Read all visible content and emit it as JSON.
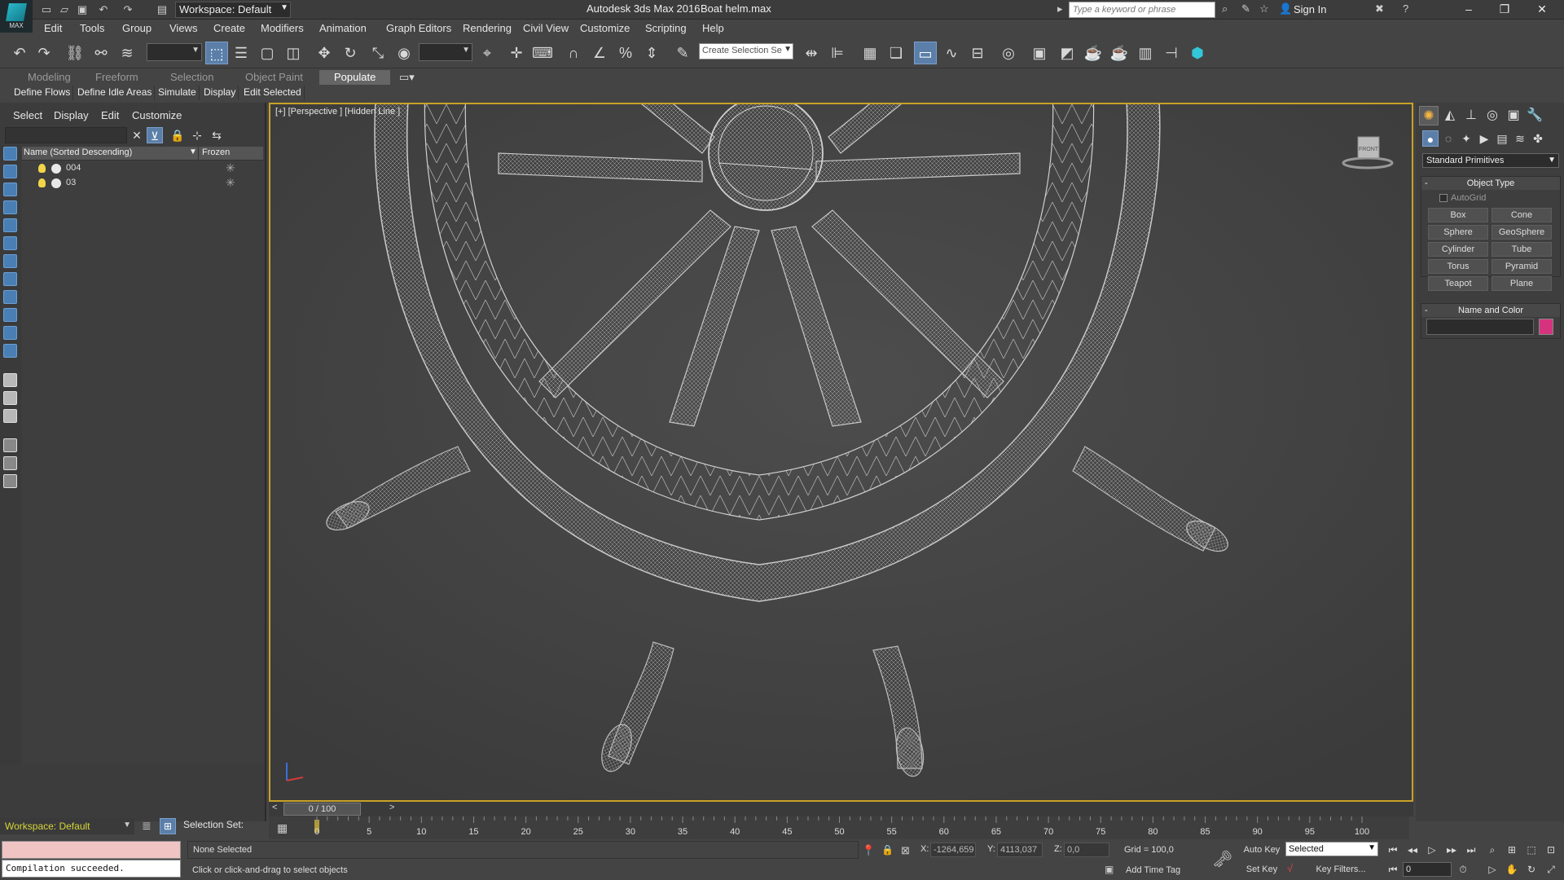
{
  "titlebar": {
    "app_title": "Autodesk 3ds Max 2016",
    "file_name": "Boat helm.max",
    "workspace": "Workspace: Default",
    "search_placeholder": "Type a keyword or phrase",
    "sign_in": "Sign In",
    "logo_text": "MAX",
    "minimize": "–",
    "restore": "❐",
    "close": "✕",
    "help": "?"
  },
  "menu": [
    "Edit",
    "Tools",
    "Group",
    "Views",
    "Create",
    "Modifiers",
    "Animation",
    "Graph Editors",
    "Rendering",
    "Civil View",
    "Customize",
    "Scripting",
    "Help"
  ],
  "toolbar": {
    "selection_set_placeholder": "Create Selection Se"
  },
  "ribbon": {
    "tabs": [
      "Modeling",
      "Freeform",
      "Selection",
      "Object Paint",
      "Populate"
    ],
    "active_tab": "Populate",
    "subtabs": [
      "Define Flows",
      "Define Idle Areas",
      "Simulate",
      "Display",
      "Edit Selected"
    ]
  },
  "scene_explorer": {
    "menus": [
      "Select",
      "Display",
      "Edit",
      "Customize"
    ],
    "columns": {
      "name": "Name (Sorted Descending)",
      "frozen": "Frozen"
    },
    "rows": [
      {
        "name": "004"
      },
      {
        "name": "03"
      }
    ]
  },
  "viewport": {
    "label": "[+] [Perspective ] [Hidden Line ]",
    "viewcube_label": "FRONT",
    "border_color": "#c9a227"
  },
  "command_panel": {
    "dropdown": "Standard Primitives",
    "object_type_title": "Object Type",
    "autogrid": "AutoGrid",
    "primitives": [
      "Box",
      "Cone",
      "Sphere",
      "GeoSphere",
      "Cylinder",
      "Tube",
      "Torus",
      "Pyramid",
      "Teapot",
      "Plane"
    ],
    "name_color_title": "Name and Color",
    "swatch_color": "#d6337f"
  },
  "timeline": {
    "position": "0 / 100",
    "ticks": [
      "0",
      "5",
      "10",
      "15",
      "20",
      "25",
      "30",
      "35",
      "40",
      "45",
      "50",
      "55",
      "60",
      "65",
      "70",
      "75",
      "80",
      "85",
      "90",
      "95",
      "100"
    ]
  },
  "bottom": {
    "workspace": "Workspace: Default",
    "selection_set": "Selection Set:",
    "maxscript_output": "Compilation succeeded.",
    "status_selection": "None Selected",
    "status_prompt": "Click or click-and-drag to select objects",
    "x_label": "X:",
    "x_value": "-1264,659",
    "y_label": "Y:",
    "y_value": "4113,037",
    "z_label": "Z:",
    "z_value": "0,0",
    "grid": "Grid = 100,0",
    "add_time_tag": "Add Time Tag",
    "auto_key": "Auto Key",
    "set_key": "Set Key",
    "key_mode": "Selected",
    "key_filters": "Key Filters...",
    "frame": "0"
  },
  "icons": [
    "undo-icon",
    "redo-icon",
    "link-icon",
    "unlink-icon",
    "bind-icon",
    "select-icon",
    "move-icon",
    "rotate-icon",
    "scale-icon",
    "snap-icon",
    "mirror-icon",
    "align-icon",
    "render-icon"
  ]
}
